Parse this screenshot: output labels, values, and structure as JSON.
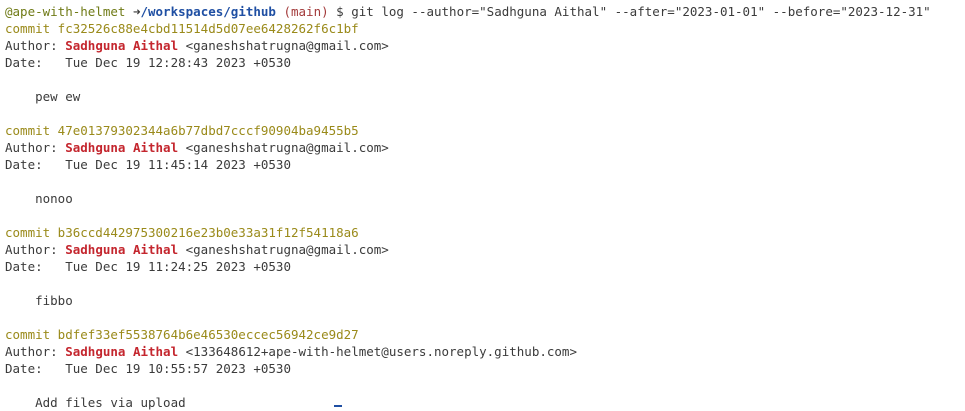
{
  "prompt": {
    "user_host": "@ape-with-helmet",
    "arrow": " ➜",
    "path": "/workspaces/github",
    "branch": "(main)",
    "command": " $ git log --author=\"Sadhguna Aithal\" --after=\"2023-01-01\" --before=\"2023-12-31\""
  },
  "commits": [
    {
      "hash_line": "commit fc32526c88e4cbd11514d5d07ee6428262f6c1bf",
      "author_label": "Author: ",
      "author_name": "Sadhguna Aithal",
      "author_email": " <ganeshshatrugna@gmail.com>",
      "date_line": "Date:   Tue Dec 19 12:28:43 2023 +0530",
      "message": "    pew ew"
    },
    {
      "hash_line": "commit 47e01379302344a6b77dbd7cccf90904ba9455b5",
      "author_label": "Author: ",
      "author_name": "Sadhguna Aithal",
      "author_email": " <ganeshshatrugna@gmail.com>",
      "date_line": "Date:   Tue Dec 19 11:45:14 2023 +0530",
      "message": "    nonoo"
    },
    {
      "hash_line": "commit b36ccd442975300216e23b0e33a31f12f54118a6",
      "author_label": "Author: ",
      "author_name": "Sadhguna Aithal",
      "author_email": " <ganeshshatrugna@gmail.com>",
      "date_line": "Date:   Tue Dec 19 11:24:25 2023 +0530",
      "message": "    fibbo"
    },
    {
      "hash_line": "commit bdfef33ef5538764b6e46530eccec56942ce9d27",
      "author_label": "Author: ",
      "author_name": "Sadhguna Aithal",
      "author_email": " <133648612+ape-with-helmet@users.noreply.github.com>",
      "date_line": "Date:   Tue Dec 19 10:55:57 2023 +0530",
      "message": "    Add files via upload"
    }
  ]
}
